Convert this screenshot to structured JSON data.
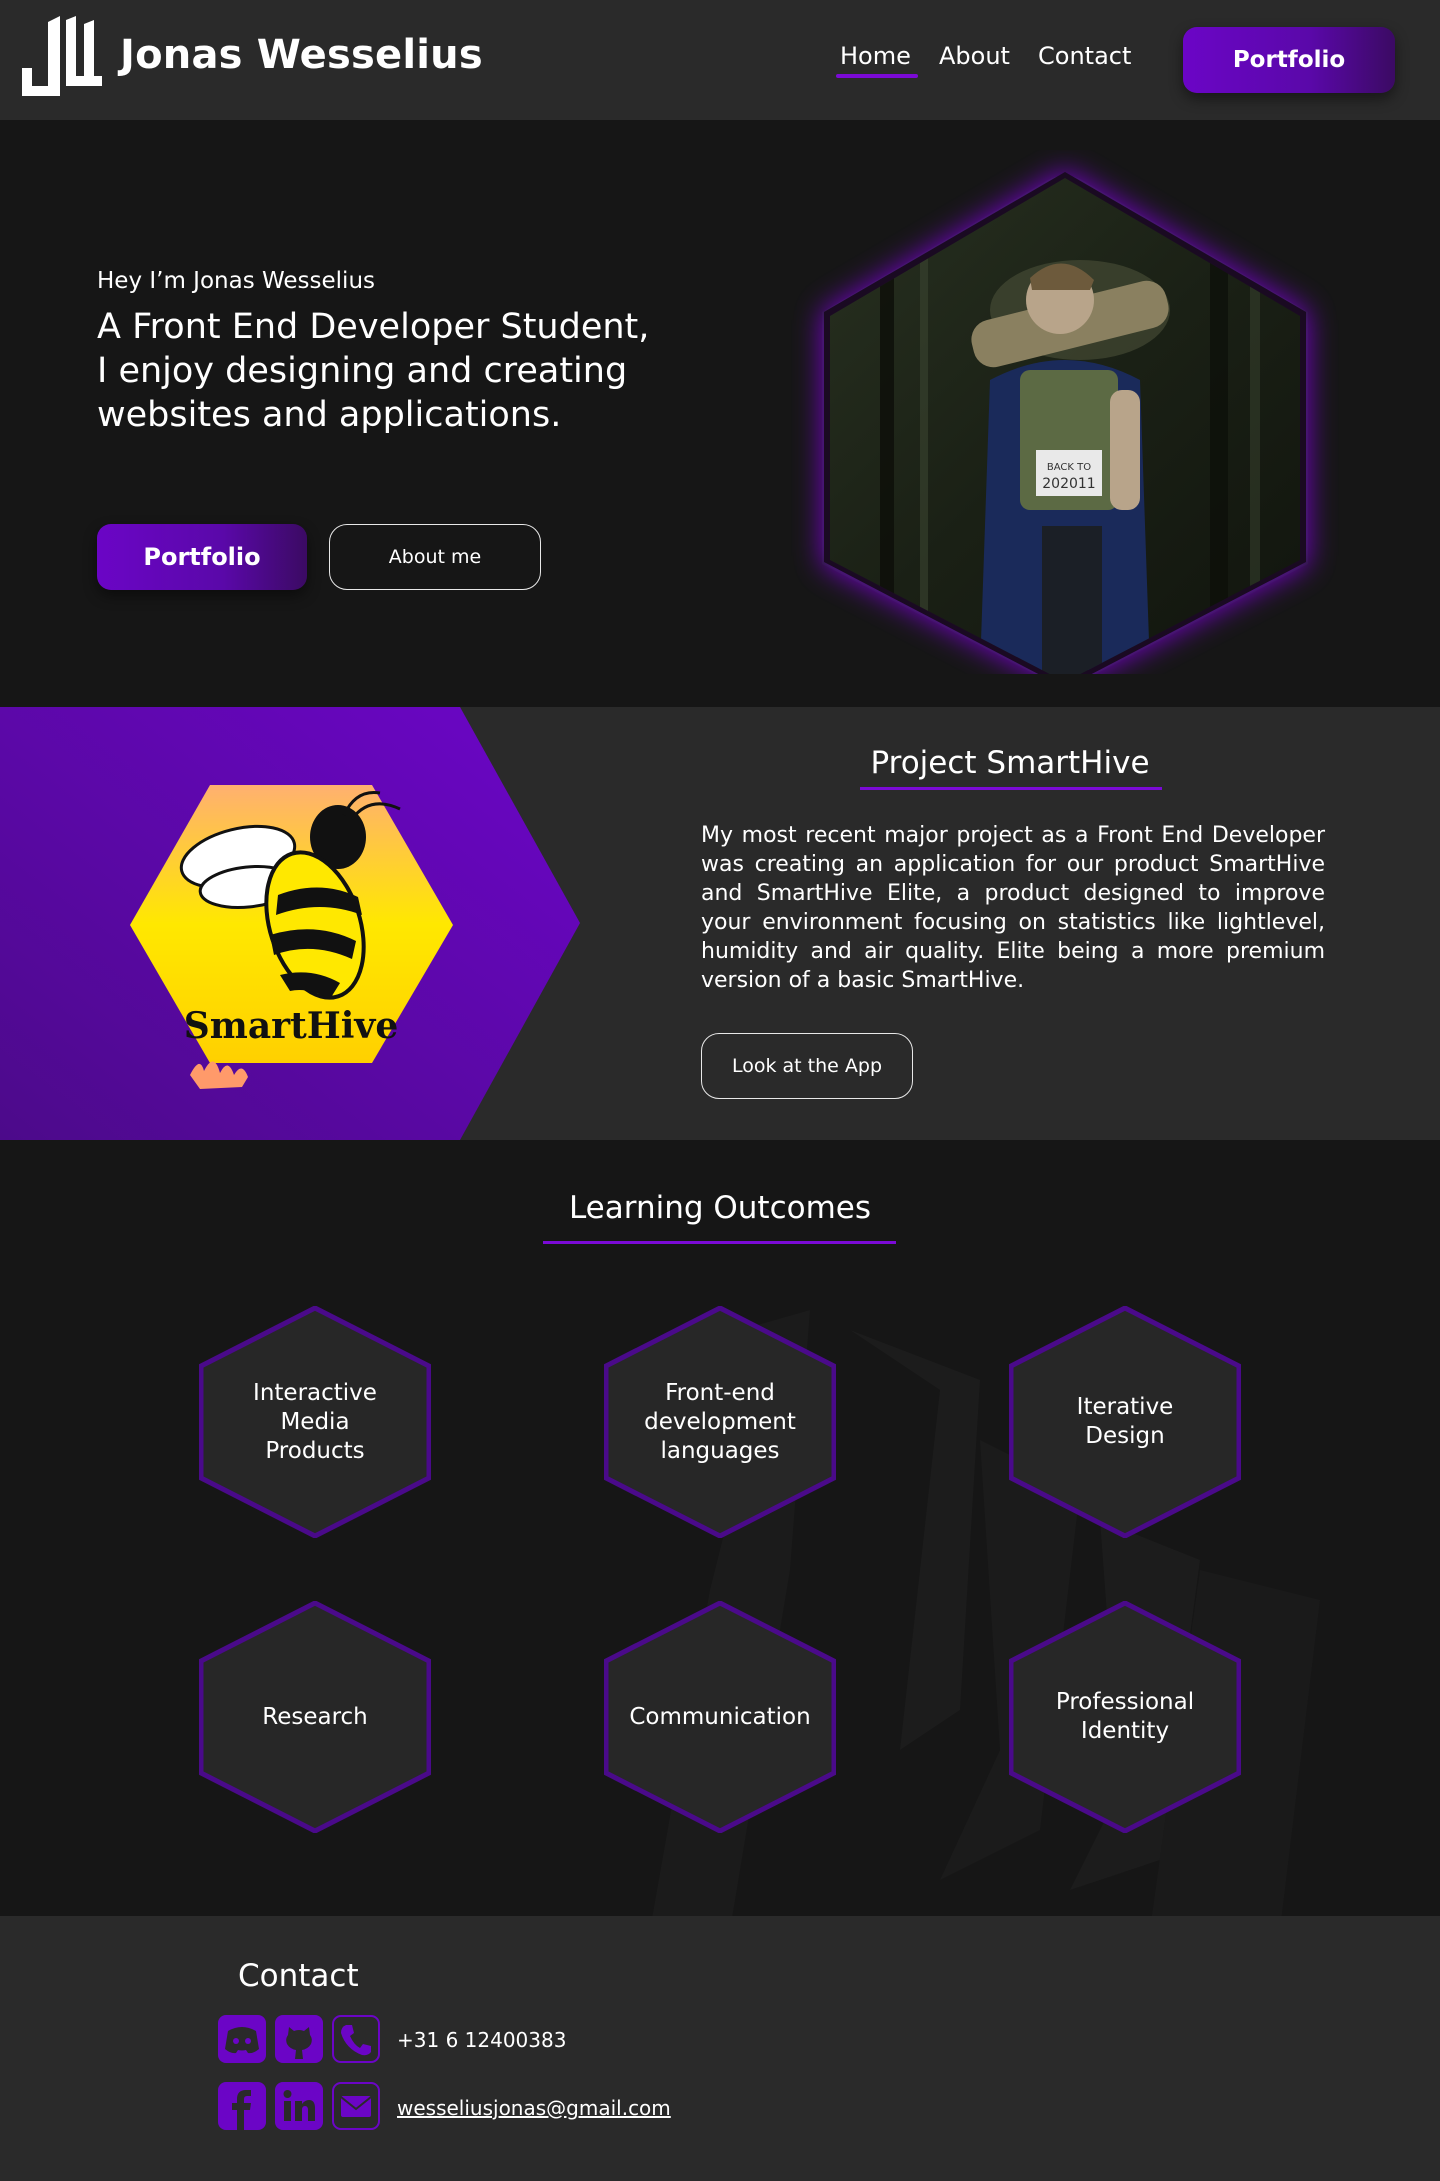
{
  "header": {
    "brand": "Jonas Wesselius",
    "logo_icon": "jw-logo-icon",
    "nav": [
      "Home",
      "About",
      "Contact"
    ],
    "active_nav": "Home",
    "cta_label": "Portfolio"
  },
  "hero": {
    "greeting": "Hey I’m Jonas Wesselius",
    "headline": "A Front End Developer Student, I enjoy designing and creating websites and applications.",
    "primary_button": "Portfolio",
    "secondary_button": "About me"
  },
  "project": {
    "title": "Project SmartHive",
    "logo_text": "SmartHive",
    "description": "My most recent major project as a Front End Developer was creating an application for our product SmartHive and SmartHive Elite, a product designed to improve your environment focusing on statistics like lightlevel, humidity and air quality. Elite being a more premium version of a basic SmartHive.",
    "button": "Look at the App"
  },
  "outcomes": {
    "title": "Learning Outcomes",
    "items": [
      [
        "Interactive",
        "Media",
        "Products"
      ],
      [
        "Front-end",
        "development",
        "languages"
      ],
      [
        "Iterative",
        "Design"
      ],
      [
        "Research"
      ],
      [
        "Communication"
      ],
      [
        "Professional",
        "Identity"
      ]
    ]
  },
  "footer": {
    "title": "Contact",
    "icons": [
      "discord-icon",
      "github-icon",
      "phone-icon",
      "facebook-icon",
      "linkedin-icon",
      "mail-icon"
    ],
    "phone": "+31 6 12400383",
    "email": "wesseliusjonas@gmail.com"
  },
  "colors": {
    "accent": "#6b05c6",
    "background": "#161616",
    "panel": "#2a2a2a"
  }
}
